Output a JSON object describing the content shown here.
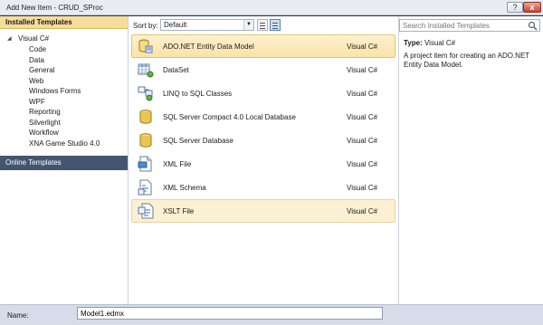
{
  "window": {
    "title": "Add New Item - CRUD_SProc"
  },
  "title_buttons": {
    "help": "?",
    "close": "x"
  },
  "left": {
    "header": "Installed Templates",
    "root": "Visual C#",
    "items": [
      "Code",
      "Data",
      "General",
      "Web",
      "Windows Forms",
      "WPF",
      "Reporting",
      "Silverlight",
      "Workflow",
      "XNA Game Studio 4.0"
    ],
    "online": "Online Templates"
  },
  "toolbar": {
    "sort_label": "Sort by:",
    "sort_value": "Default"
  },
  "templates": [
    {
      "name": "ADO.NET Entity Data Model",
      "lang": "Visual C#",
      "icon": "entity-model-icon"
    },
    {
      "name": "DataSet",
      "lang": "Visual C#",
      "icon": "dataset-icon"
    },
    {
      "name": "LINQ to SQL Classes",
      "lang": "Visual C#",
      "icon": "linq-icon"
    },
    {
      "name": "SQL Server Compact 4.0 Local Database",
      "lang": "Visual C#",
      "icon": "database-icon"
    },
    {
      "name": "SQL Server Database",
      "lang": "Visual C#",
      "icon": "database-icon"
    },
    {
      "name": "XML File",
      "lang": "Visual C#",
      "icon": "xml-file-icon"
    },
    {
      "name": "XML Schema",
      "lang": "Visual C#",
      "icon": "xml-schema-icon"
    },
    {
      "name": "XSLT File",
      "lang": "Visual C#",
      "icon": "xslt-file-icon"
    }
  ],
  "right": {
    "search_placeholder": "Search Installed Templates",
    "type_label": "Type:",
    "type_value": "Visual C#",
    "description": "A project item for creating an ADO.NET Entity Data Model."
  },
  "bottom": {
    "name_label": "Name:",
    "name_value": "Model1.edmx"
  },
  "colors": {
    "selection": "#f9e3a7",
    "online_bg": "#44556f",
    "header_bg": "#f6dd9a"
  }
}
